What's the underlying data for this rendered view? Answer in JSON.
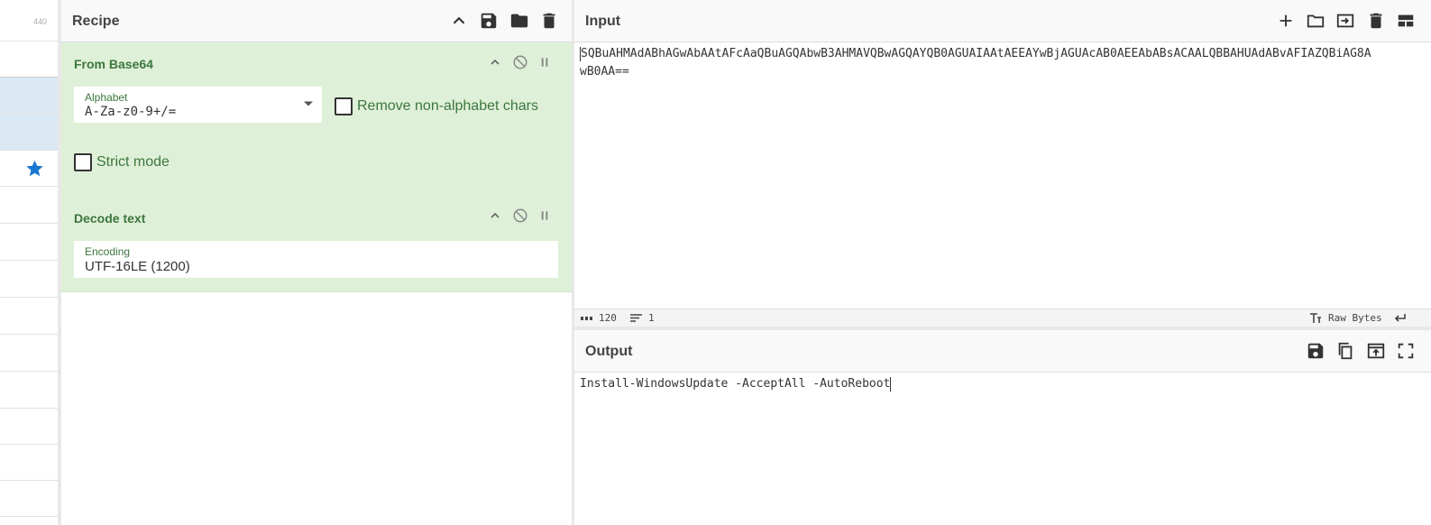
{
  "leftcol": {
    "top_number": "440"
  },
  "recipe": {
    "title": "Recipe",
    "operations": [
      {
        "title": "From Base64",
        "alphabet_label": "Alphabet",
        "alphabet_value": "A-Za-z0-9+/=",
        "remove_label": "Remove non-alphabet chars",
        "strict_label": "Strict mode"
      },
      {
        "title": "Decode text",
        "encoding_label": "Encoding",
        "encoding_value": "UTF-16LE (1200)"
      }
    ]
  },
  "input": {
    "title": "Input",
    "line1": "SQBuAHMAdABhAGwAbAAtAFcAaQBuAGQAbwB3AHMAVQBwAGQAYQB0AGUAIAAtAEEAYwBjAGUAcAB0AEEAbABsACAALQBBAHUAdABvAFIAZQBiAG8A",
    "line2": "wB0AA==",
    "status_length": "120",
    "status_lines": "1",
    "status_format": "Raw Bytes"
  },
  "output": {
    "title": "Output",
    "text": "Install-WindowsUpdate -AcceptAll -AutoReboot"
  },
  "colors": {
    "op_bg": "#dff0d8",
    "op_text": "#3c763d",
    "star": "#1976d2"
  }
}
